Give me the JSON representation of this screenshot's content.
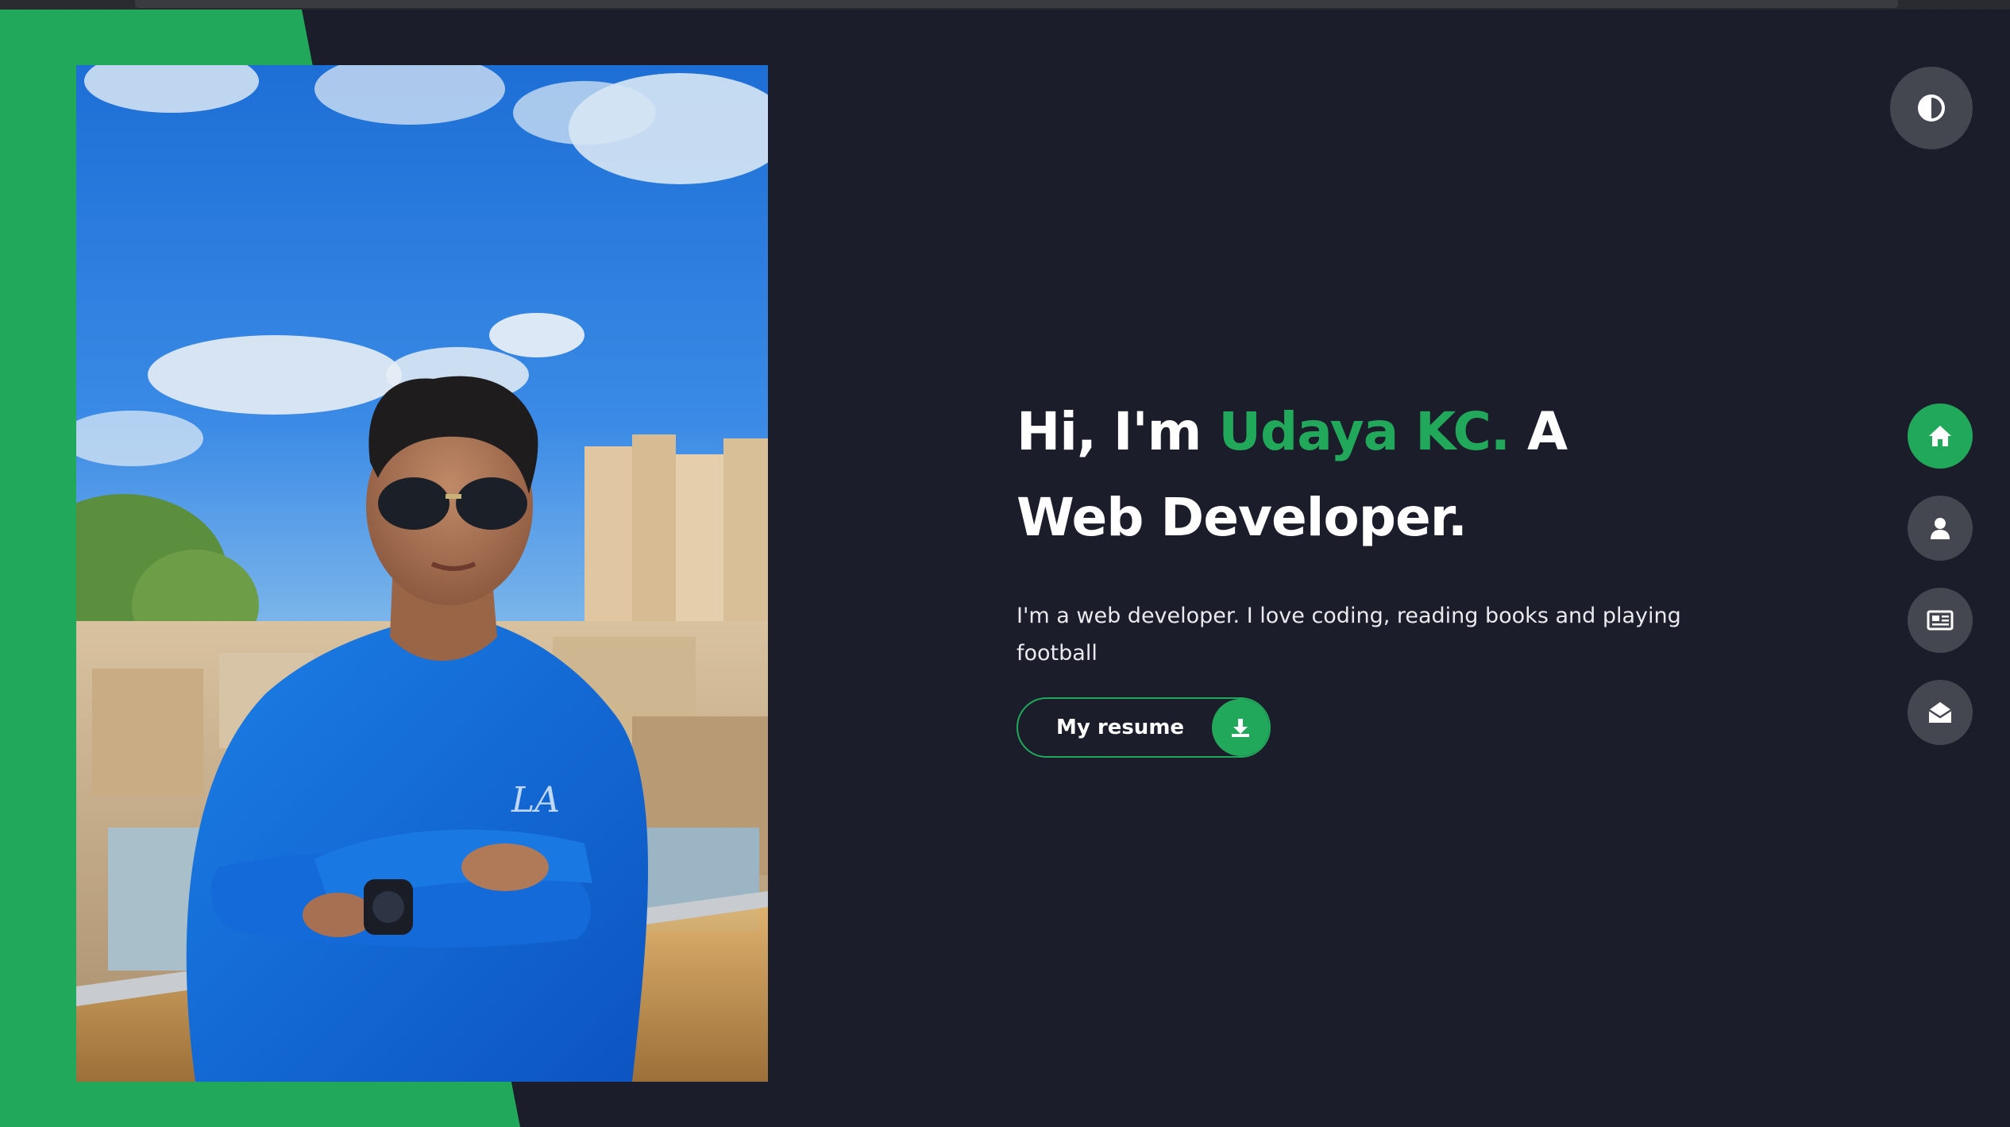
{
  "hero": {
    "greeting": "Hi, I'm ",
    "name": "Udaya KC.",
    "role_line1": " A",
    "role_line2": "Web Developer.",
    "description": "I'm a web developer. I love coding, reading books and playing football",
    "resume_label": "My resume"
  },
  "nav": {
    "items": [
      {
        "name": "home",
        "icon": "home-icon",
        "active": true
      },
      {
        "name": "about",
        "icon": "user-icon",
        "active": false
      },
      {
        "name": "portfolio",
        "icon": "newspaper-icon",
        "active": false
      },
      {
        "name": "contact",
        "icon": "envelope-open-icon",
        "active": false
      }
    ]
  },
  "theme_toggle": {
    "icon": "contrast-icon"
  },
  "photo": {
    "alt": "portrait-photo"
  },
  "colors": {
    "accent": "#22a85b",
    "background": "#1b1d2a",
    "nav_button": "#454750",
    "text": "#ffffff"
  }
}
